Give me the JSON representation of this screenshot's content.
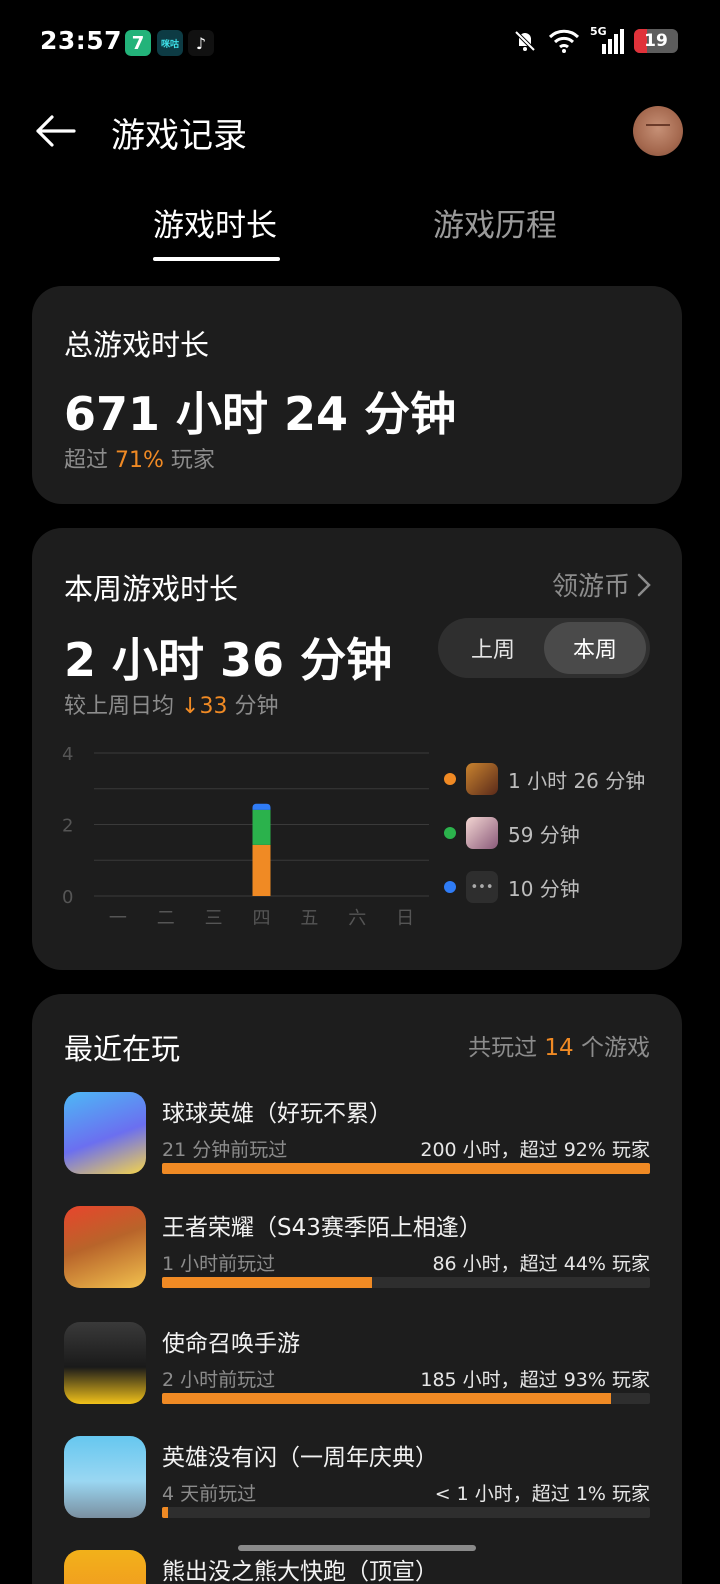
{
  "status_bar": {
    "time": "23:57",
    "apps": [
      "7",
      "咪咕",
      "♪"
    ],
    "signal_label": "5G",
    "battery": "19",
    "icons": [
      "mute-bell-icon",
      "wifi-icon",
      "signal-icon",
      "battery-icon"
    ]
  },
  "header": {
    "title": "游戏记录",
    "back_icon": "back-arrow-icon"
  },
  "tabs": [
    {
      "label": "游戏时长",
      "active": true
    },
    {
      "label": "游戏历程",
      "active": false
    }
  ],
  "total": {
    "label": "总游戏时长",
    "value": "671 小时 24 分钟",
    "sub_prefix": "超过",
    "sub_percent": "71%",
    "sub_suffix": "玩家"
  },
  "weekly": {
    "label": "本周游戏时长",
    "link_label": "领游币",
    "value": "2 小时 36 分钟",
    "sub_prefix": "较上周日均",
    "sub_delta": "↓33",
    "sub_suffix": "分钟",
    "toggle": [
      "上周",
      "本周"
    ],
    "toggle_selected": "本周",
    "legend": [
      {
        "text": "1 小时 26 分钟",
        "color": "#f08a24"
      },
      {
        "text": "59 分钟",
        "color": "#2bb24c"
      },
      {
        "text": "10 分钟",
        "color": "#2f7cf6"
      }
    ]
  },
  "chart_data": {
    "type": "bar",
    "categories": [
      "一",
      "二",
      "三",
      "四",
      "五",
      "六",
      "日"
    ],
    "series": [
      {
        "values": [
          0,
          0,
          0,
          1.43,
          0,
          0,
          0
        ],
        "color": "#f08a24"
      },
      {
        "values": [
          0,
          0,
          0,
          0.98,
          0,
          0,
          0
        ],
        "color": "#2bb24c"
      },
      {
        "values": [
          0,
          0,
          0,
          0.17,
          0,
          0,
          0
        ],
        "color": "#2f7cf6"
      }
    ],
    "stacked": true,
    "yticks": [
      0,
      2,
      4
    ],
    "ylim": [
      0,
      4
    ],
    "grid": true
  },
  "recent": {
    "label": "最近在玩",
    "count_prefix": "共玩过",
    "count": "14",
    "count_suffix": "个游戏",
    "games": [
      {
        "name": "球球英雄（好玩不累）",
        "last": "21 分钟前玩过",
        "stat": "200 小时，超过 92% 玩家",
        "progress": 1.0
      },
      {
        "name": "王者荣耀（S43赛季陌上相逢）",
        "last": "1 小时前玩过",
        "stat": "86 小时，超过 44% 玩家",
        "progress": 0.43
      },
      {
        "name": "使命召唤手游",
        "last": "2 小时前玩过",
        "stat": "185 小时，超过 93% 玩家",
        "progress": 0.92
      },
      {
        "name": "英雄没有闪（一周年庆典）",
        "last": "4 天前玩过",
        "stat": "< 1 小时，超过 1% 玩家",
        "progress": 0.01
      },
      {
        "name": "熊出没之熊大快跑（顶宣）",
        "last": "",
        "stat": "",
        "progress": 0
      }
    ]
  }
}
